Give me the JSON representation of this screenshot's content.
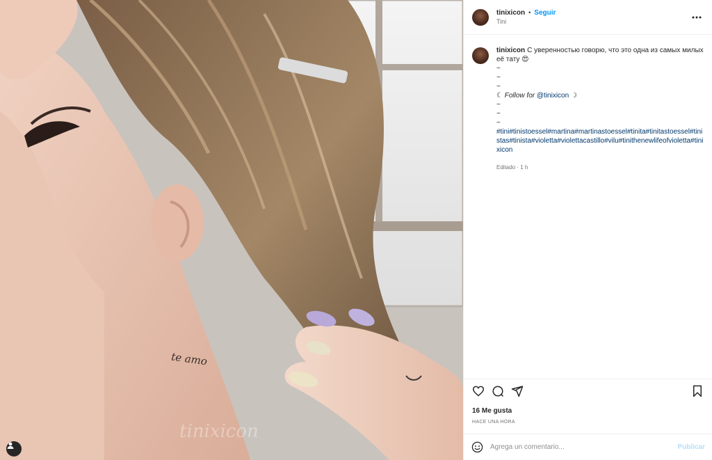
{
  "header": {
    "username": "tinixicon",
    "separator": "•",
    "follow_label": "Seguir",
    "subtitle": "Tini",
    "more_icon": "more-horizontal-icon"
  },
  "caption": {
    "username": "tinixicon",
    "text": "С уверенностью говорю, что это одна из самых милых её тату 😍",
    "tilde_lines_1": [
      "~",
      "~",
      "~"
    ],
    "follow_prefix": "☾ ",
    "follow_text": "Follow for",
    "follow_handle": "@tinixicon",
    "follow_suffix": " ☽",
    "tilde_lines_2": [
      "~",
      "~",
      "~"
    ],
    "hashtags": "#tini#tinistoessel#martina#martinastoessel#tinita#tinitastoessel#tinistas#tinista#violetta#violettacastillo#vilu#tinithenewlifeofvioletta#tinixicon",
    "edited": "Editado · 1 h"
  },
  "actions": {
    "like_icon": "heart-icon",
    "comment_icon": "comment-icon",
    "share_icon": "share-icon",
    "save_icon": "bookmark-icon"
  },
  "likes": "16 Me gusta",
  "time": "HACE UNA HORA",
  "comment_box": {
    "emoji_icon": "emoji-icon",
    "placeholder": "Agrega un comentario...",
    "publish_label": "Publicar"
  },
  "media": {
    "tattoo_text": "te amo",
    "watermark": "tinixicon",
    "tag_icon": "user-tag-icon"
  }
}
